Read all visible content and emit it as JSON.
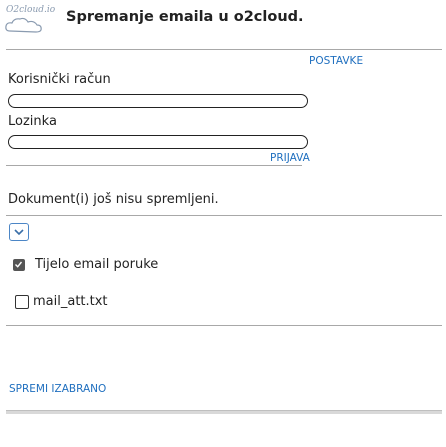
{
  "header": {
    "logo_text": "O2cloud.io",
    "title": "Spremanje emaila u o2cloud."
  },
  "settings_link": "POSTAVKE",
  "account_label": "Korisnički račun",
  "account_value": "",
  "password_label": "Lozinka",
  "password_value": "",
  "login_link": "PRIJAVA",
  "status_message": "Dokument(i) još nisu spremljeni.",
  "items": [
    {
      "label": "Tijelo email poruke",
      "checked": true
    },
    {
      "label": "mail_att.txt",
      "checked": false
    }
  ],
  "save_selected_link": "SPREMI IZABRANO",
  "colors": {
    "link": "#1f6fbf",
    "divider": "#a8a8a8",
    "expand_border": "#4c86c6"
  },
  "icons": {
    "expand": "chevron-down-icon",
    "checked": "check-icon"
  }
}
